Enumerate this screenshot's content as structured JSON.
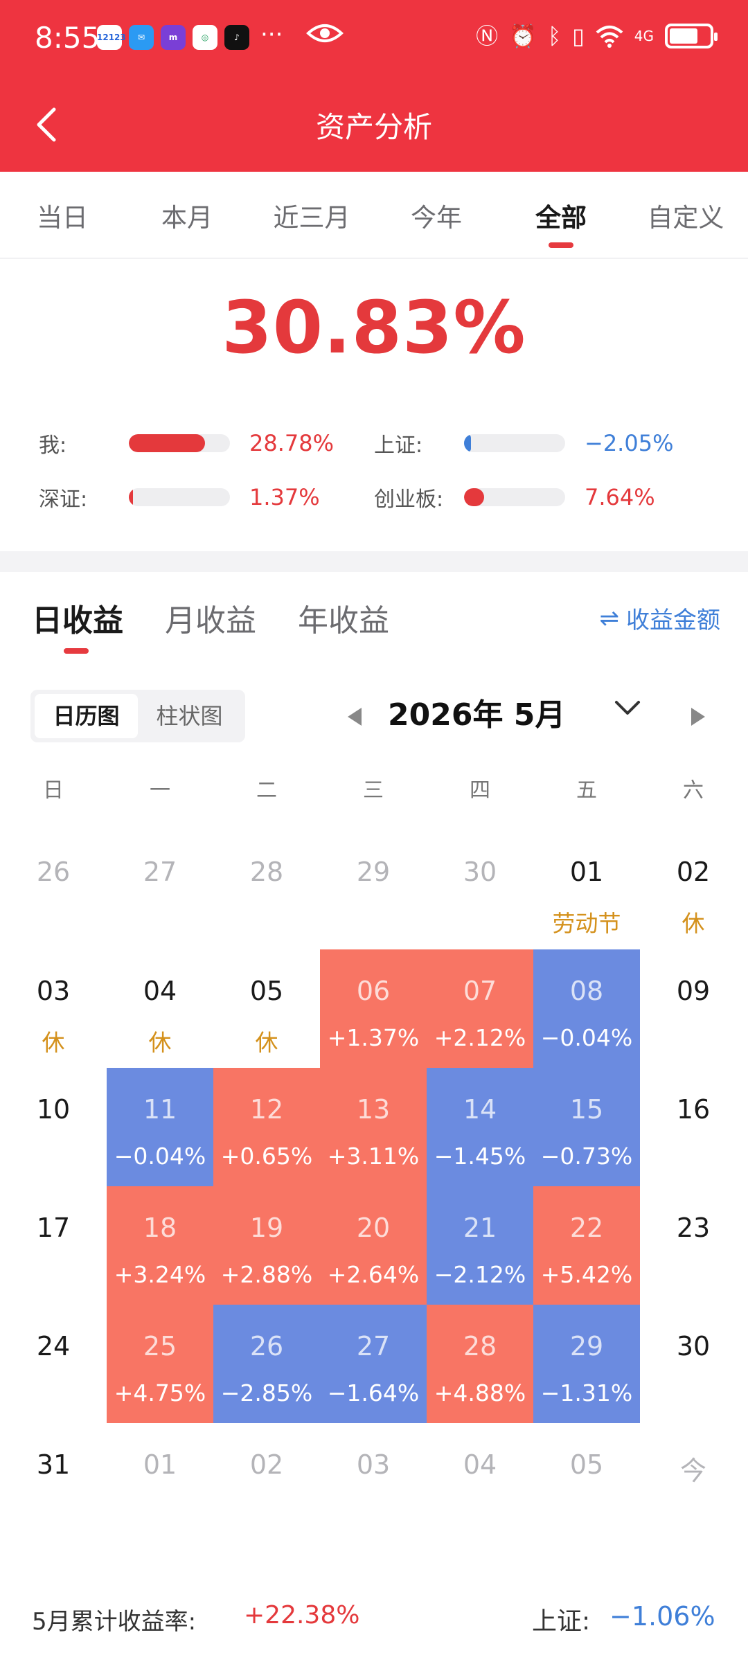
{
  "status_bar": {
    "time": "8:55",
    "app_icons": [
      "12123",
      "messages",
      "metro",
      "bank",
      "tiktok"
    ],
    "more": "···",
    "network": "4G",
    "battery_level": 0.72
  },
  "header": {
    "title": "资产分析"
  },
  "period_tabs": [
    {
      "label": "当日",
      "active": false
    },
    {
      "label": "本月",
      "active": false
    },
    {
      "label": "近三月",
      "active": false
    },
    {
      "label": "今年",
      "active": false
    },
    {
      "label": "全部",
      "active": true
    },
    {
      "label": "自定义",
      "active": false
    }
  ],
  "total_return": "30.83%",
  "comparison": [
    {
      "label": "我:",
      "value": "28.78%",
      "level": 0.75,
      "color": "#e4393c"
    },
    {
      "label": "上证:",
      "value": "−2.05%",
      "level": 0.07,
      "color": "#3f7fd8"
    },
    {
      "label": "深证:",
      "value": "1.37%",
      "level": 0.04,
      "color": "#e4393c"
    },
    {
      "label": "创业板:",
      "value": "7.64%",
      "level": 0.2,
      "color": "#e4393c"
    }
  ],
  "earnings_tabs": [
    {
      "label": "日收益",
      "active": true
    },
    {
      "label": "月收益",
      "active": false
    },
    {
      "label": "年收益",
      "active": false
    }
  ],
  "amount_toggle": "收益金额",
  "view_switch": {
    "calendar": "日历图",
    "bar": "柱状图"
  },
  "month_label": "2026年 5月",
  "weekdays": [
    "日",
    "一",
    "二",
    "三",
    "四",
    "五",
    "六"
  ],
  "calendar": [
    [
      {
        "date": "26",
        "sub": "",
        "type": "other"
      },
      {
        "date": "27",
        "sub": "",
        "type": "other"
      },
      {
        "date": "28",
        "sub": "",
        "type": "other"
      },
      {
        "date": "29",
        "sub": "",
        "type": "other"
      },
      {
        "date": "30",
        "sub": "",
        "type": "other"
      },
      {
        "date": "01",
        "sub": "劳动节",
        "type": "holiday"
      },
      {
        "date": "02",
        "sub": "休",
        "type": "holiday"
      }
    ],
    [
      {
        "date": "03",
        "sub": "休",
        "type": "holiday"
      },
      {
        "date": "04",
        "sub": "休",
        "type": "holiday"
      },
      {
        "date": "05",
        "sub": "休",
        "type": "holiday"
      },
      {
        "date": "06",
        "sub": "+1.37%",
        "type": "up"
      },
      {
        "date": "07",
        "sub": "+2.12%",
        "type": "up"
      },
      {
        "date": "08",
        "sub": "−0.04%",
        "type": "down"
      },
      {
        "date": "09",
        "sub": "",
        "type": "normal"
      }
    ],
    [
      {
        "date": "10",
        "sub": "",
        "type": "normal"
      },
      {
        "date": "11",
        "sub": "−0.04%",
        "type": "down"
      },
      {
        "date": "12",
        "sub": "+0.65%",
        "type": "up"
      },
      {
        "date": "13",
        "sub": "+3.11%",
        "type": "up"
      },
      {
        "date": "14",
        "sub": "−1.45%",
        "type": "down"
      },
      {
        "date": "15",
        "sub": "−0.73%",
        "type": "down"
      },
      {
        "date": "16",
        "sub": "",
        "type": "normal"
      }
    ],
    [
      {
        "date": "17",
        "sub": "",
        "type": "normal"
      },
      {
        "date": "18",
        "sub": "+3.24%",
        "type": "up"
      },
      {
        "date": "19",
        "sub": "+2.88%",
        "type": "up"
      },
      {
        "date": "20",
        "sub": "+2.64%",
        "type": "up"
      },
      {
        "date": "21",
        "sub": "−2.12%",
        "type": "down"
      },
      {
        "date": "22",
        "sub": "+5.42%",
        "type": "up"
      },
      {
        "date": "23",
        "sub": "",
        "type": "normal"
      }
    ],
    [
      {
        "date": "24",
        "sub": "",
        "type": "normal"
      },
      {
        "date": "25",
        "sub": "+4.75%",
        "type": "up"
      },
      {
        "date": "26",
        "sub": "−2.85%",
        "type": "down"
      },
      {
        "date": "27",
        "sub": "−1.64%",
        "type": "down"
      },
      {
        "date": "28",
        "sub": "+4.88%",
        "type": "up"
      },
      {
        "date": "29",
        "sub": "−1.31%",
        "type": "down"
      },
      {
        "date": "30",
        "sub": "",
        "type": "normal"
      }
    ],
    [
      {
        "date": "31",
        "sub": "",
        "type": "normal"
      },
      {
        "date": "01",
        "sub": "",
        "type": "other"
      },
      {
        "date": "02",
        "sub": "",
        "type": "other"
      },
      {
        "date": "03",
        "sub": "",
        "type": "other"
      },
      {
        "date": "04",
        "sub": "",
        "type": "other"
      },
      {
        "date": "05",
        "sub": "",
        "type": "other"
      },
      {
        "date": "今",
        "sub": "",
        "type": "other"
      }
    ]
  ],
  "summary": {
    "label": "5月累计收益率:",
    "value": "+22.38%",
    "index_label": "上证:",
    "index_value": "−1.06%"
  },
  "colors": {
    "brand": "#ee3440",
    "up": "#f87564",
    "down": "#6b8be0",
    "holiday": "#d4911c"
  }
}
